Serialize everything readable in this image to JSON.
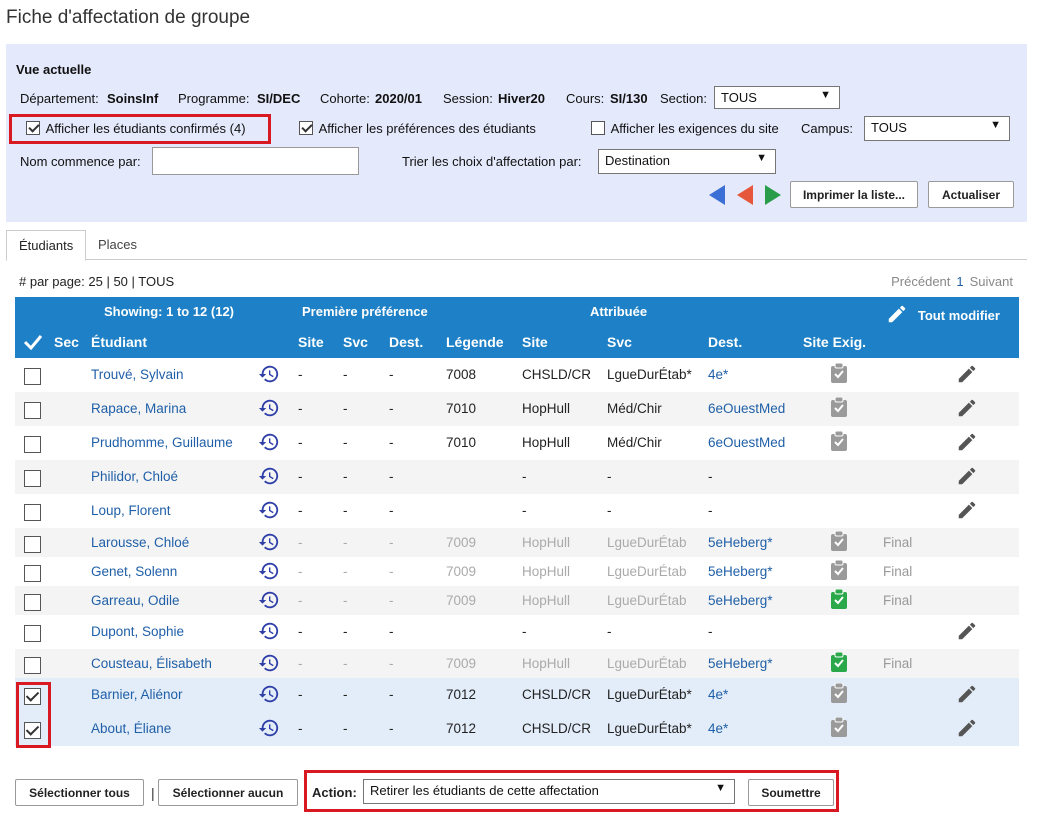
{
  "page": {
    "title": "Fiche d'affectation de groupe"
  },
  "current_view": {
    "title": "Vue actuelle",
    "department_label": "Département:",
    "department": "SoinsInf",
    "program_label": "Programme:",
    "program": "SI/DEC",
    "cohort_label": "Cohorte:",
    "cohort": "2020/01",
    "session_label": "Session:",
    "session": "Hiver20",
    "course_label": "Cours:",
    "course": "SI/130",
    "section_label": "Section:",
    "section": "TOUS",
    "show_confirmed": {
      "label": "Afficher les étudiants confirmés (4)",
      "checked": true
    },
    "show_preferences": {
      "label": "Afficher les préférences des étudiants",
      "checked": true
    },
    "show_site_req": {
      "label": "Afficher les exigences du site",
      "checked": false
    },
    "campus_label": "Campus:",
    "campus": "TOUS",
    "name_starts_label": "Nom commence par:",
    "name_starts_value": "",
    "sort_label": "Trier les choix d'affectation par:",
    "sort_value": "Destination",
    "print_button": "Imprimer la liste...",
    "refresh_button": "Actualiser",
    "colors": {
      "blue_arrow": "#3b6fd6",
      "red_arrow": "#e5563b",
      "green_arrow": "#2a9d4a"
    }
  },
  "tabs": [
    "Étudiants",
    "Places"
  ],
  "pagination": {
    "per_page_label": "# par page: 25 | 50 | TOUS",
    "prev": "Précédent",
    "current": "1",
    "next": "Suivant"
  },
  "table": {
    "showing": "Showing: 1 to 12 (12)",
    "group_first_pref": "Première préférence",
    "group_assigned": "Attribuée",
    "edit_all": "Tout modifier",
    "headers": {
      "sec": "Sec",
      "student": "Étudiant",
      "site": "Site",
      "svc": "Svc",
      "dest": "Dest.",
      "legend": "Légende",
      "a_site": "Site",
      "a_svc": "Svc",
      "a_dest": "Dest.",
      "site_req": "Site Exig."
    },
    "rows": [
      {
        "name": "Trouvé, Sylvain",
        "p_site": "-",
        "p_svc": "-",
        "p_dest": "-",
        "legend": "7008",
        "site": "CHSLD/CR",
        "svc": "LgueDurÉtab*",
        "dest": "4e*",
        "req": "grey",
        "status": "",
        "edit": true,
        "checked": false,
        "grey": false
      },
      {
        "name": "Rapace, Marina",
        "p_site": "-",
        "p_svc": "-",
        "p_dest": "-",
        "legend": "7010",
        "site": "HopHull",
        "svc": "Méd/Chir",
        "dest": "6eOuestMed",
        "req": "grey",
        "status": "",
        "edit": true,
        "checked": false,
        "grey": false
      },
      {
        "name": "Prudhomme, Guillaume",
        "p_site": "-",
        "p_svc": "-",
        "p_dest": "-",
        "legend": "7010",
        "site": "HopHull",
        "svc": "Méd/Chir",
        "dest": "6eOuestMed",
        "req": "grey",
        "status": "",
        "edit": true,
        "checked": false,
        "grey": false
      },
      {
        "name": "Philidor, Chloé",
        "p_site": "-",
        "p_svc": "-",
        "p_dest": "-",
        "legend": "",
        "site": "-",
        "svc": "-",
        "dest": "-",
        "req": "",
        "status": "",
        "edit": true,
        "checked": false,
        "grey": false
      },
      {
        "name": "Loup, Florent",
        "p_site": "-",
        "p_svc": "-",
        "p_dest": "-",
        "legend": "",
        "site": "-",
        "svc": "-",
        "dest": "-",
        "req": "",
        "status": "",
        "edit": true,
        "checked": false,
        "grey": false
      },
      {
        "name": "Larousse, Chloé",
        "p_site": "-",
        "p_svc": "-",
        "p_dest": "-",
        "legend": "7009",
        "site": "HopHull",
        "svc": "LgueDurÉtab",
        "dest": "5eHeberg*",
        "req": "grey",
        "status": "Final",
        "edit": false,
        "checked": false,
        "grey": true
      },
      {
        "name": "Genet, Solenn",
        "p_site": "-",
        "p_svc": "-",
        "p_dest": "-",
        "legend": "7009",
        "site": "HopHull",
        "svc": "LgueDurÉtab",
        "dest": "5eHeberg*",
        "req": "grey",
        "status": "Final",
        "edit": false,
        "checked": false,
        "grey": true
      },
      {
        "name": "Garreau, Odile",
        "p_site": "-",
        "p_svc": "-",
        "p_dest": "-",
        "legend": "7009",
        "site": "HopHull",
        "svc": "LgueDurÉtab",
        "dest": "5eHeberg*",
        "req": "green",
        "status": "Final",
        "edit": false,
        "checked": false,
        "grey": true
      },
      {
        "name": "Dupont, Sophie",
        "p_site": "-",
        "p_svc": "-",
        "p_dest": "-",
        "legend": "",
        "site": "-",
        "svc": "-",
        "dest": "-",
        "req": "",
        "status": "",
        "edit": true,
        "checked": false,
        "grey": false
      },
      {
        "name": "Cousteau, Élisabeth",
        "p_site": "-",
        "p_svc": "-",
        "p_dest": "-",
        "legend": "7009",
        "site": "HopHull",
        "svc": "LgueDurÉtab",
        "dest": "5eHeberg*",
        "req": "green",
        "status": "Final",
        "edit": false,
        "checked": false,
        "grey": true
      },
      {
        "name": "Barnier, Aliénor",
        "p_site": "-",
        "p_svc": "-",
        "p_dest": "-",
        "legend": "7012",
        "site": "CHSLD/CR",
        "svc": "LgueDurÉtab*",
        "dest": "4e*",
        "req": "grey",
        "status": "",
        "edit": true,
        "checked": true,
        "grey": false
      },
      {
        "name": "About, Éliane",
        "p_site": "-",
        "p_svc": "-",
        "p_dest": "-",
        "legend": "7012",
        "site": "CHSLD/CR",
        "svc": "LgueDurÉtab*",
        "dest": "4e*",
        "req": "grey",
        "status": "",
        "edit": true,
        "checked": true,
        "grey": false
      }
    ]
  },
  "bottom": {
    "select_all": "Sélectionner tous",
    "separator": "|",
    "select_none": "Sélectionner aucun",
    "action_label": "Action:",
    "action_value": "Retirer les étudiants de cette affectation",
    "submit": "Soumettre"
  }
}
